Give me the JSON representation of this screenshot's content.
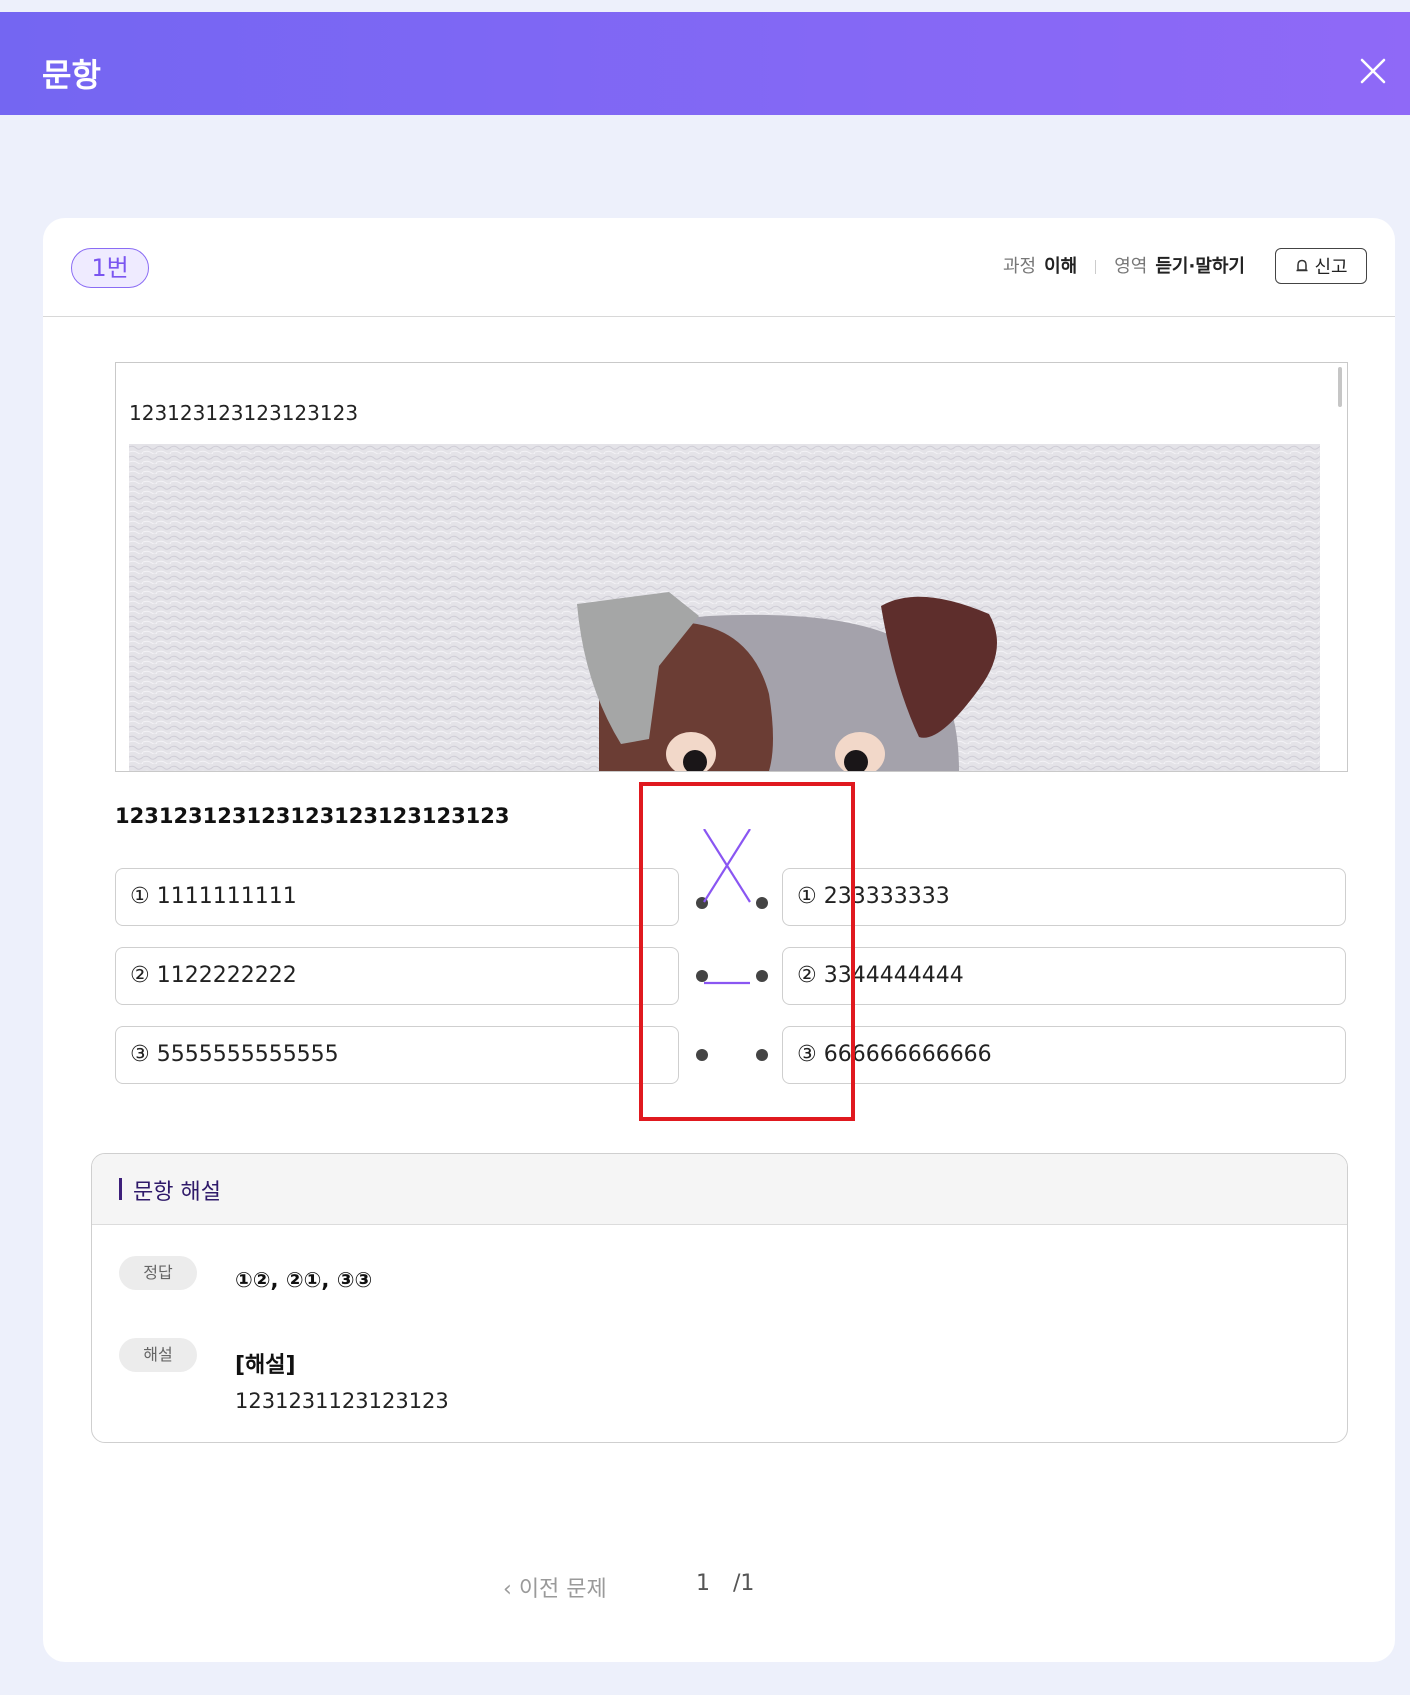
{
  "header": {
    "title": "문항"
  },
  "card": {
    "question_badge": "1번",
    "meta": [
      {
        "key": "과정",
        "value": "이해"
      },
      {
        "key": "영역",
        "value": "듣기·말하기"
      }
    ],
    "report_label": "신고"
  },
  "passage": {
    "text": "123123123123123123"
  },
  "question": {
    "text": "123123123123123123123123123"
  },
  "matching": {
    "left": [
      "① 1111111111",
      "② 1122222222",
      "③ 5555555555555"
    ],
    "right": [
      "① 233333333",
      "② 3344444444",
      "③ 666666666666"
    ],
    "link_color": "#8a56f2"
  },
  "explanation": {
    "title": "문항 해설",
    "answer_label": "정답",
    "answer_value": "①②, ②①, ③③",
    "solution_label": "해설",
    "solution_heading": "[해설]",
    "solution_text": "1231231123123123"
  },
  "pagination": {
    "prev_label": "이전 문제",
    "current": "1",
    "total": "/1"
  },
  "colors": {
    "header_start": "#7466f2",
    "header_end": "#8f69f7",
    "accent": "#8a56f2",
    "highlight_box": "#e0191f"
  }
}
